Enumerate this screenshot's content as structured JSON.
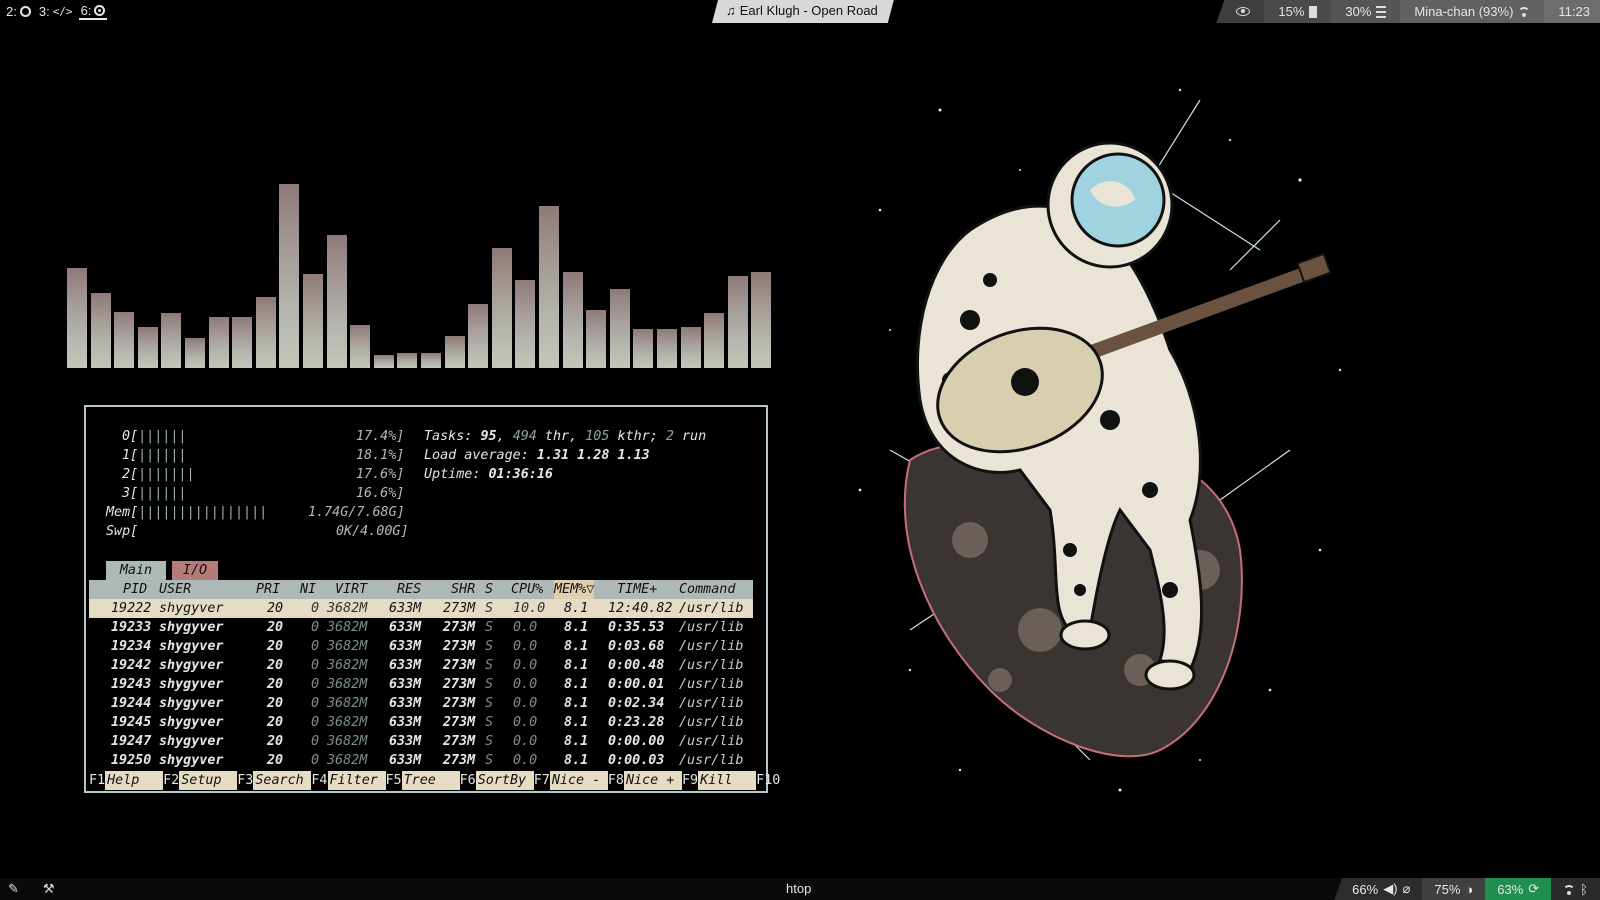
{
  "topbar": {
    "workspaces": [
      {
        "label": "2:",
        "icon": "chrome-icon"
      },
      {
        "label": "3:",
        "icon": "code-icon"
      },
      {
        "label": "6:",
        "icon": "record-icon",
        "active": true
      }
    ],
    "now_playing": "Earl Klugh - Open Road",
    "status": {
      "brightness": "15%",
      "volume": "30%",
      "wifi": "Mina-chan (93%)",
      "clock": "11:23"
    }
  },
  "visualizer": {
    "levels": [
      0.53,
      0.4,
      0.3,
      0.22,
      0.29,
      0.16,
      0.27,
      0.27,
      0.38,
      0.98,
      0.5,
      0.71,
      0.23,
      0.07,
      0.08,
      0.08,
      0.17,
      0.34,
      0.64,
      0.47,
      0.86,
      0.51,
      0.31,
      0.42,
      0.21,
      0.21,
      0.22,
      0.29,
      0.49,
      0.51
    ],
    "colors": {
      "top": "#8e7a78",
      "bottom": "#c3c6ba"
    }
  },
  "htop": {
    "cpus": [
      {
        "label": "0[",
        "bar": "||||||",
        "value": "17.4%]"
      },
      {
        "label": "1[",
        "bar": "||||||",
        "value": "18.1%]"
      },
      {
        "label": "2[",
        "bar": "|||||||",
        "value": "17.6%]"
      },
      {
        "label": "3[",
        "bar": "||||||",
        "value": "16.6%]"
      }
    ],
    "mem": {
      "label": "Mem[",
      "bar": "||||||||||||||||",
      "value": "1.74G/7.68G]"
    },
    "swp": {
      "label": "Swp[",
      "bar": "",
      "value": "0K/4.00G]"
    },
    "tasks": {
      "prefix": "Tasks: ",
      "tasks": "95",
      "sep1": ", ",
      "thr": "494",
      "thr_label": " thr, ",
      "kthr": "105",
      "kthr_label": " kthr; ",
      "run": "2",
      "run_label": " run"
    },
    "load": {
      "label": "Load average: ",
      "value": "1.31 1.28 1.13"
    },
    "uptime": {
      "label": "Uptime: ",
      "value": "01:36:16"
    },
    "tabs": {
      "main": "Main",
      "io": "I/O"
    },
    "columns": {
      "pid": "PID",
      "user": "USER",
      "pri": "PRI",
      "ni": "NI",
      "virt": "VIRT",
      "res": "RES",
      "shr": "SHR",
      "s": "S",
      "cpu": "CPU%",
      "mem": "MEM%▽",
      "time": "TIME+",
      "command": "Command"
    },
    "processes": [
      {
        "pid": "19222",
        "user": "shygyver",
        "pri": "20",
        "ni": "0",
        "virt": "3682M",
        "res": "633M",
        "shr": "273M",
        "s": "S",
        "cpu": "10.0",
        "mem": "8.1",
        "time": "12:40.82",
        "command": "/usr/lib",
        "selected": true
      },
      {
        "pid": "19233",
        "user": "shygyver",
        "pri": "20",
        "ni": "0",
        "virt": "3682M",
        "res": "633M",
        "shr": "273M",
        "s": "S",
        "cpu": "0.0",
        "mem": "8.1",
        "time": "0:35.53",
        "command": "/usr/lib"
      },
      {
        "pid": "19234",
        "user": "shygyver",
        "pri": "20",
        "ni": "0",
        "virt": "3682M",
        "res": "633M",
        "shr": "273M",
        "s": "S",
        "cpu": "0.0",
        "mem": "8.1",
        "time": "0:03.68",
        "command": "/usr/lib"
      },
      {
        "pid": "19242",
        "user": "shygyver",
        "pri": "20",
        "ni": "0",
        "virt": "3682M",
        "res": "633M",
        "shr": "273M",
        "s": "S",
        "cpu": "0.0",
        "mem": "8.1",
        "time": "0:00.48",
        "command": "/usr/lib"
      },
      {
        "pid": "19243",
        "user": "shygyver",
        "pri": "20",
        "ni": "0",
        "virt": "3682M",
        "res": "633M",
        "shr": "273M",
        "s": "S",
        "cpu": "0.0",
        "mem": "8.1",
        "time": "0:00.01",
        "command": "/usr/lib"
      },
      {
        "pid": "19244",
        "user": "shygyver",
        "pri": "20",
        "ni": "0",
        "virt": "3682M",
        "res": "633M",
        "shr": "273M",
        "s": "S",
        "cpu": "0.0",
        "mem": "8.1",
        "time": "0:02.34",
        "command": "/usr/lib"
      },
      {
        "pid": "19245",
        "user": "shygyver",
        "pri": "20",
        "ni": "0",
        "virt": "3682M",
        "res": "633M",
        "shr": "273M",
        "s": "S",
        "cpu": "0.0",
        "mem": "8.1",
        "time": "0:23.28",
        "command": "/usr/lib"
      },
      {
        "pid": "19247",
        "user": "shygyver",
        "pri": "20",
        "ni": "0",
        "virt": "3682M",
        "res": "633M",
        "shr": "273M",
        "s": "S",
        "cpu": "0.0",
        "mem": "8.1",
        "time": "0:00.00",
        "command": "/usr/lib"
      },
      {
        "pid": "19250",
        "user": "shygyver",
        "pri": "20",
        "ni": "0",
        "virt": "3682M",
        "res": "633M",
        "shr": "273M",
        "s": "S",
        "cpu": "0.0",
        "mem": "8.1",
        "time": "0:00.03",
        "command": "/usr/lib"
      }
    ],
    "fkeys": [
      {
        "key": "F1",
        "label": "Help"
      },
      {
        "key": "F2",
        "label": "Setup"
      },
      {
        "key": "F3",
        "label": "Search"
      },
      {
        "key": "F4",
        "label": "Filter"
      },
      {
        "key": "F5",
        "label": "Tree"
      },
      {
        "key": "F6",
        "label": "SortBy"
      },
      {
        "key": "F7",
        "label": "Nice -"
      },
      {
        "key": "F8",
        "label": "Nice +"
      },
      {
        "key": "F9",
        "label": "Kill"
      },
      {
        "key": "F10",
        "label": ""
      }
    ]
  },
  "bottombar": {
    "window_title": "htop",
    "volume": "66%",
    "brightness": "75%",
    "battery": "63%"
  }
}
